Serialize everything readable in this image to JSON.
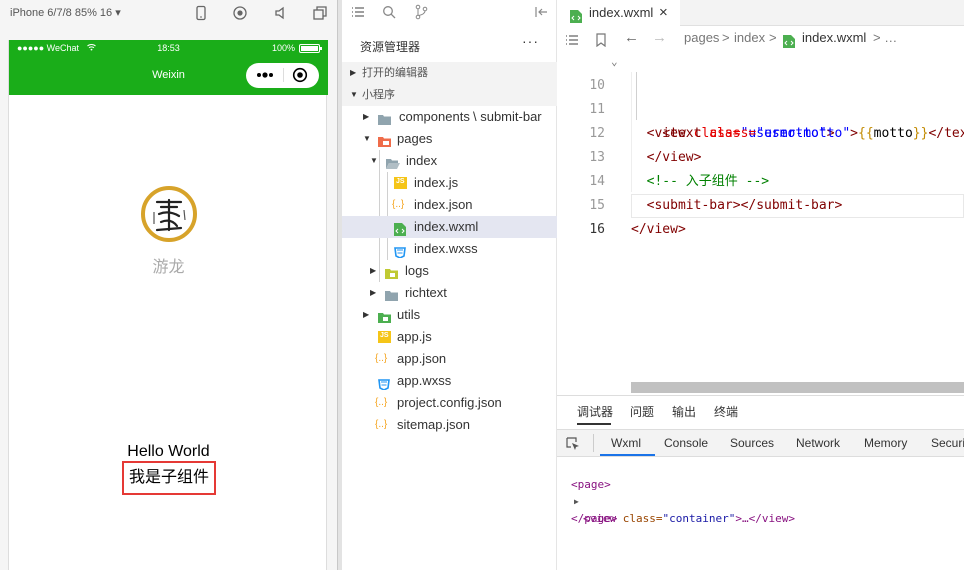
{
  "simulator": {
    "device_label": "iPhone 6/7/8 85% 16 ▾",
    "status_left": "●●●●● WeChat",
    "status_time": "18:53",
    "status_battery": "100%",
    "nav_title": "Weixin",
    "nickname": "游龙",
    "hello_text": "Hello World",
    "submit_bar_text": "我是子组件"
  },
  "explorer": {
    "title": "资源管理器",
    "more": "···",
    "section_open_editors": "打开的编辑器",
    "section_project": "小程序",
    "tree": [
      {
        "label": "components",
        "suffix": "\\ submit-bar"
      },
      {
        "label": "pages"
      },
      {
        "label": "index"
      },
      {
        "label": "index.js"
      },
      {
        "label": "index.json"
      },
      {
        "label": "index.wxml"
      },
      {
        "label": "index.wxss"
      },
      {
        "label": "logs"
      },
      {
        "label": "richtext"
      },
      {
        "label": "utils"
      },
      {
        "label": "app.js"
      },
      {
        "label": "app.json"
      },
      {
        "label": "app.wxss"
      },
      {
        "label": "project.config.json"
      },
      {
        "label": "sitemap.json"
      }
    ],
    "icon_labels": {
      "js": "JS",
      "json": "{..}"
    }
  },
  "editor": {
    "tab_label": "index.wxml",
    "tab_close": "×",
    "breadcrumb": {
      "pages": "pages",
      "sep": ">",
      "index": "index",
      "file": "index.wxml",
      "more": "> …"
    },
    "lines": [
      {
        "num": "10",
        "indent": "  ",
        "open": "<view ",
        "attr": "class=",
        "val": "\"usermotto\"",
        "close": ">"
      },
      {
        "num": "11",
        "indent": "    ",
        "open": "<text ",
        "attr": "class=",
        "val": "\"user-motto\"",
        "close": ">",
        "mustache_open": "{{",
        "expr": "motto",
        "mustache_close": "}}",
        "tail": "</text"
      },
      {
        "num": "12",
        "indent": "  ",
        "tag": "</view>"
      },
      {
        "num": "13",
        "indent": "  ",
        "comment": "<!-- 入子组件 -->"
      },
      {
        "num": "14",
        "indent": "  ",
        "tag": "<submit-bar></submit-bar>"
      },
      {
        "num": "15",
        "indent": "",
        "tag": "</view>"
      },
      {
        "num": "16",
        "indent": "",
        "tag": ""
      }
    ]
  },
  "debugger": {
    "tabs": [
      "调试器",
      "问题",
      "输出",
      "终端"
    ],
    "devtools_tabs": [
      "Wxml",
      "Console",
      "Sources",
      "Network",
      "Memory",
      "Securi"
    ],
    "xml": {
      "page_open": "<page>",
      "view_open": "<view ",
      "view_attr": "class=",
      "view_val": "\"container\"",
      "view_mid": ">…</view>",
      "page_close": "</page>"
    }
  },
  "colors": {
    "nav_green": "#1aad19",
    "submit_border": "#e53935",
    "avatar_ring": "#d7a32a"
  }
}
